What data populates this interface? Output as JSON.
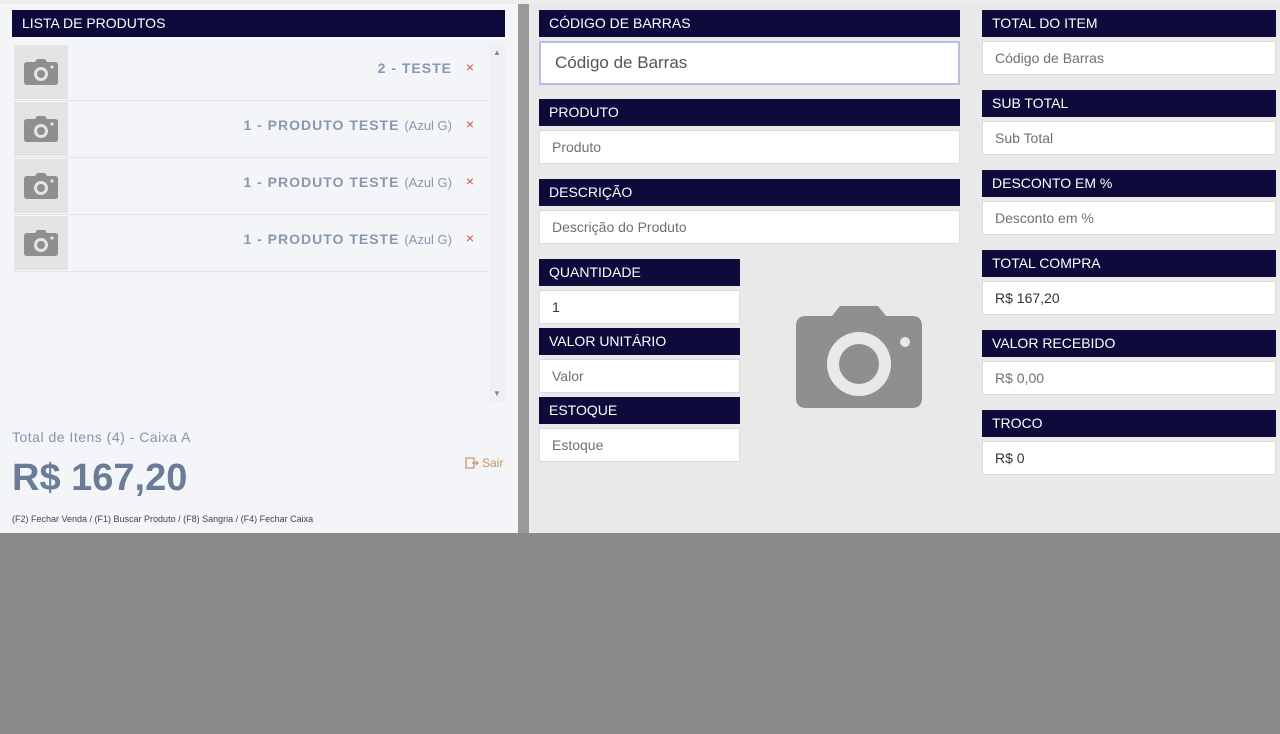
{
  "left": {
    "header": "LISTA DE PRODUTOS",
    "items": [
      {
        "name": "2 - TESTE",
        "variant": "",
        "remove": "×"
      },
      {
        "name": "1 - PRODUTO TESTE",
        "variant": "(Azul G)",
        "remove": "×"
      },
      {
        "name": "1 - PRODUTO TESTE",
        "variant": "(Azul G)",
        "remove": "×"
      },
      {
        "name": "1 - PRODUTO TESTE",
        "variant": "(Azul G)",
        "remove": "×"
      }
    ],
    "total_label": "Total de Itens (4) - Caixa A",
    "total_value": "R$ 167,20",
    "exit_label": "Sair",
    "shortcuts": "(F2) Fechar Venda / (F1) Buscar Produto / (F8) Sangria / (F4) Fechar Caixa"
  },
  "middle": {
    "barcode": {
      "label": "CÓDIGO DE BARRAS",
      "placeholder": "Código de Barras"
    },
    "product": {
      "label": "PRODUTO",
      "placeholder": "Produto"
    },
    "description": {
      "label": "DESCRIÇÃO",
      "placeholder": "Descrição do Produto"
    },
    "quantity": {
      "label": "QUANTIDADE",
      "value": "1"
    },
    "unit_value": {
      "label": "VALOR UNITÁRIO",
      "placeholder": "Valor"
    },
    "stock": {
      "label": "ESTOQUE",
      "placeholder": "Estoque"
    }
  },
  "right": {
    "item_total": {
      "label": "TOTAL DO ITEM",
      "placeholder": "Código de Barras"
    },
    "subtotal": {
      "label": "SUB TOTAL",
      "placeholder": "Sub Total"
    },
    "discount": {
      "label": "DESCONTO EM %",
      "placeholder": "Desconto em %"
    },
    "purchase_total": {
      "label": "TOTAL COMPRA",
      "value": "R$ 167,20"
    },
    "received": {
      "label": "VALOR RECEBIDO",
      "value": "R$ 0,00"
    },
    "change": {
      "label": "TROCO",
      "value": "R$ 0"
    }
  },
  "colors": {
    "header_bg": "#0e0a3c",
    "accent_remove": "#c85a3a",
    "exit": "#c9925e"
  },
  "icons": [
    "camera-icon",
    "close-icon",
    "exit-icon",
    "scroll-up-icon",
    "scroll-down-icon"
  ]
}
